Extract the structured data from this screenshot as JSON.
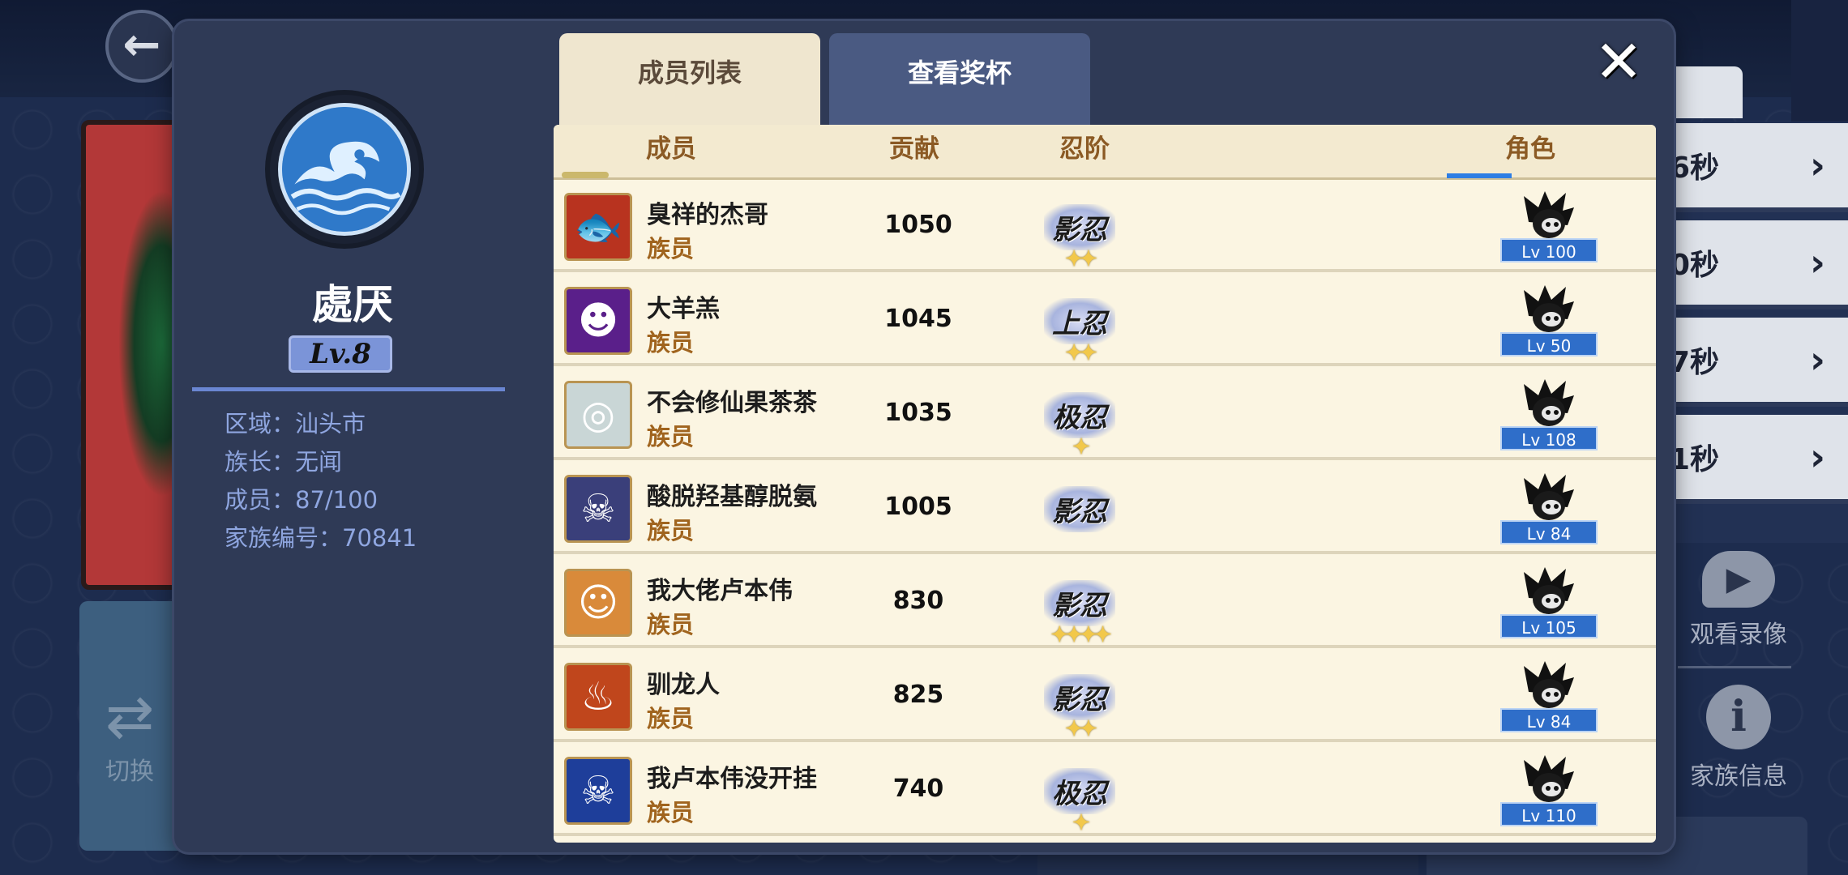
{
  "family": {
    "name": "處厌",
    "level": "Lv.8",
    "region": "区域：汕头市",
    "leader": "族长：无闻",
    "members": "成员：87/100",
    "id": "家族编号：70841"
  },
  "tabs": {
    "members": "成员列表",
    "trophy": "查看奖杯"
  },
  "close_icon": "✕",
  "table": {
    "headers": {
      "member": "成员",
      "contribution": "贡献",
      "rank": "忍阶",
      "role": "角色"
    },
    "rows": [
      {
        "name": "臭祥的杰哥",
        "title": "族员",
        "contribution": "1050",
        "rank": "影忍",
        "stars": "✦✦",
        "role_level": "Lv 100",
        "avatar_icon": "koi-fish-avatar",
        "avatar_color": "#b8331f"
      },
      {
        "name": "大羊羔",
        "title": "族员",
        "contribution": "1045",
        "rank": "上忍",
        "stars": "✦✦",
        "role_level": "Lv 50",
        "avatar_icon": "shadow-demon-avatar",
        "avatar_color": "#5a1f8a"
      },
      {
        "name": "不会修仙果茶茶",
        "title": "族员",
        "contribution": "1035",
        "rank": "极忍",
        "stars": "✦",
        "role_level": "Lv 108",
        "avatar_icon": "glasses-book-avatar",
        "avatar_color": "#c9d6d6"
      },
      {
        "name": "酸脱羟基醇脱氨",
        "title": "族员",
        "contribution": "1005",
        "rank": "影忍",
        "stars": "",
        "role_level": "Lv 84",
        "avatar_icon": "red-hair-ninja-avatar",
        "avatar_color": "#3a3f7a"
      },
      {
        "name": "我大佬卢本伟",
        "title": "族员",
        "contribution": "830",
        "rank": "影忍",
        "stars": "✦✦✦✦",
        "role_level": "Lv 105",
        "avatar_icon": "fox-girl-avatar",
        "avatar_color": "#d98a3a"
      },
      {
        "name": "驯龙人",
        "title": "族员",
        "contribution": "825",
        "rank": "影忍",
        "stars": "✦✦",
        "role_level": "Lv 84",
        "avatar_icon": "fire-dragon-avatar",
        "avatar_color": "#c0461c"
      },
      {
        "name": "我卢本伟没开挂",
        "title": "族员",
        "contribution": "740",
        "rank": "极忍",
        "stars": "✦",
        "role_level": "Lv 110",
        "avatar_icon": "crowned-skull-avatar",
        "avatar_color": "#1e3e9a"
      }
    ]
  },
  "background": {
    "switch_label": "切换",
    "right_rows": [
      "6秒",
      "0秒",
      "7秒",
      "1秒"
    ],
    "video_label": "观看录像",
    "info_label": "家族信息"
  }
}
